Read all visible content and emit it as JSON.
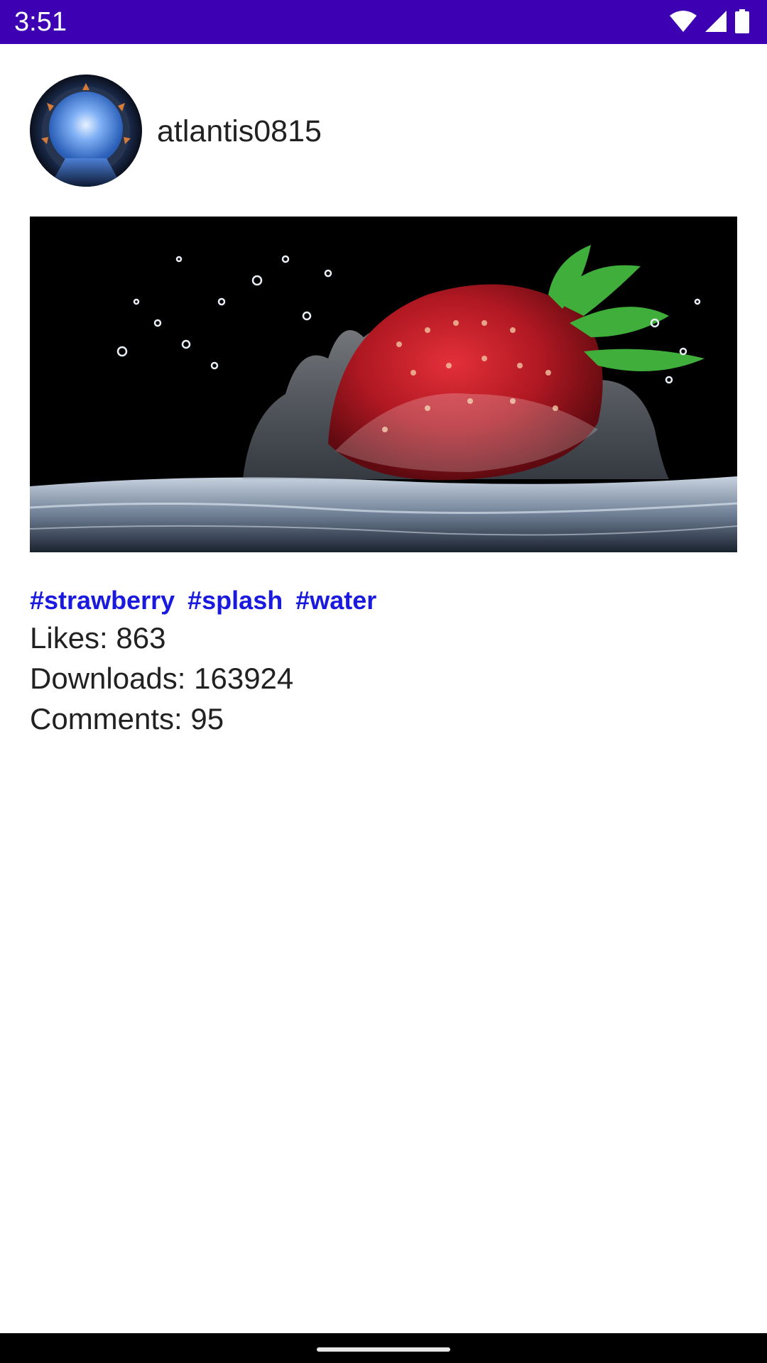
{
  "status_bar": {
    "time": "3:51",
    "icons": [
      "wifi-icon",
      "cellular-signal-icon",
      "battery-icon"
    ],
    "background_color": "#3d00b3"
  },
  "post": {
    "username": "atlantis0815",
    "avatar_icon": "stargate-avatar",
    "image_subject": "strawberry-splash-photo",
    "tags": [
      "#strawberry",
      "#splash",
      "#water"
    ],
    "tag_color": "#1a1adf",
    "likes_text": "Likes: 863",
    "downloads_text": "Downloads: 163924",
    "comments_text": "Comments: 95"
  },
  "nav_bar": {
    "home_indicator": "home-indicator"
  }
}
